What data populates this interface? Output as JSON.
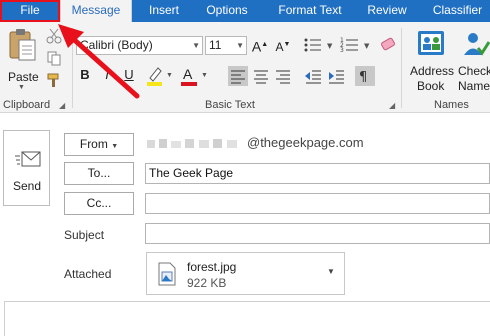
{
  "tabs": [
    {
      "label": "File"
    },
    {
      "label": "Message"
    },
    {
      "label": "Insert"
    },
    {
      "label": "Options"
    },
    {
      "label": "Format Text"
    },
    {
      "label": "Review"
    },
    {
      "label": "Classifier"
    }
  ],
  "ribbon": {
    "clipboard": {
      "paste_label": "Paste",
      "group_label": "Clipboard"
    },
    "basic_text": {
      "font_name": "Calibri (Body)",
      "font_size": "11",
      "grow_font": "A",
      "shrink_font": "A",
      "bold": "B",
      "italic": "I",
      "underline": "U",
      "font_color_label": "A",
      "group_label": "Basic Text"
    },
    "names": {
      "address_book_line1": "Address",
      "address_book_line2": "Book",
      "check_names_line1": "Check",
      "check_names_line2": "Name",
      "group_label": "Names"
    }
  },
  "compose": {
    "send_label": "Send",
    "from_label": "From",
    "from_email": "@thegeekpage.com",
    "to_label": "To...",
    "to_value": "The Geek Page",
    "cc_label": "Cc...",
    "cc_value": "",
    "subject_label": "Subject",
    "subject_value": "",
    "attached_label": "Attached",
    "attachment": {
      "filename": "forest.jpg",
      "size": "922 KB"
    }
  },
  "colors": {
    "tab_bar": "#1f6fc2",
    "highlight": "#e8101a",
    "font_color_bar": "#d9141e",
    "highlight_bar": "#f5e51a"
  }
}
